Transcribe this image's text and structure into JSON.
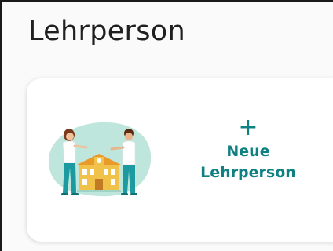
{
  "page": {
    "title": "Lehrperson"
  },
  "card": {
    "plus_symbol": "+",
    "add_label": "Neue Lehrperson",
    "illustration_icon": "teachers-school-illustration"
  },
  "colors": {
    "accent": "#0f8182",
    "blob": "#bfe6dc",
    "card_bg": "#ffffff",
    "page_bg": "#fafafa"
  }
}
